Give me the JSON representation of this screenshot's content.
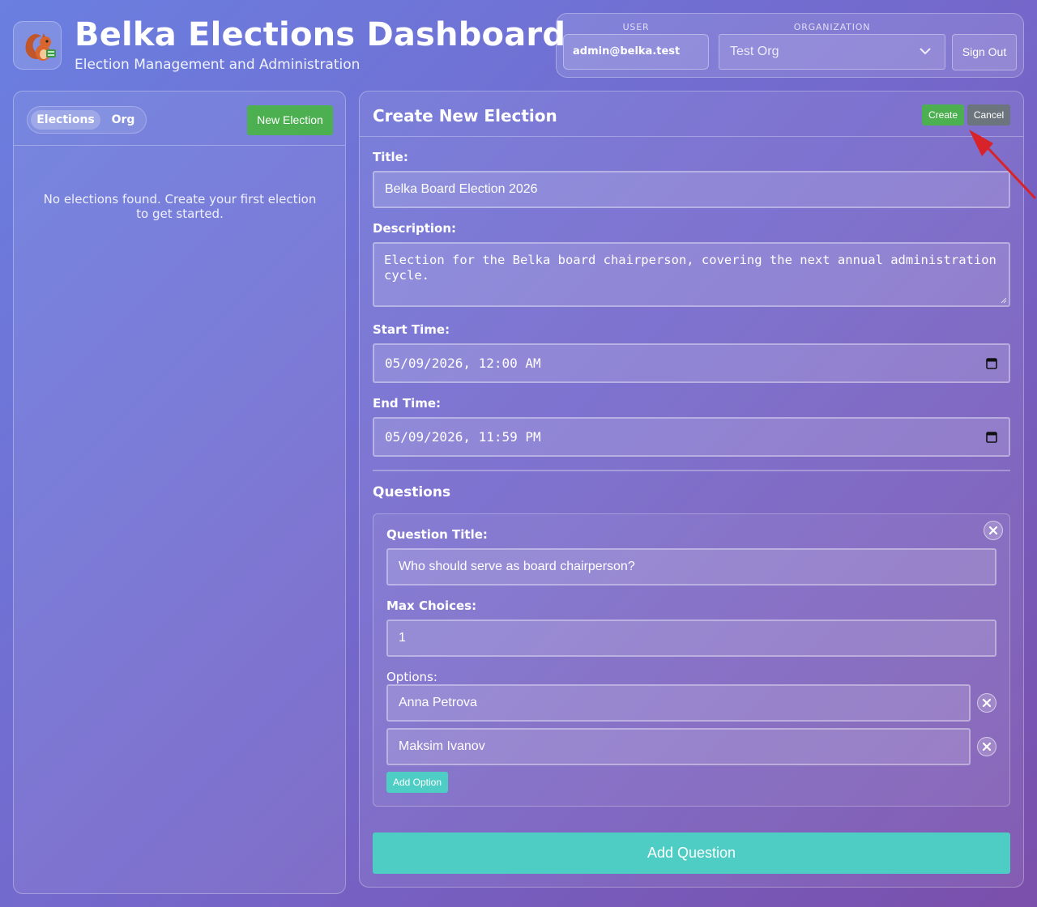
{
  "header": {
    "app_title": "Belka Elections Dashboard",
    "app_subtitle": "Election Management and Administration",
    "user_label": "USER",
    "user_value": "admin@belka.test",
    "org_label": "ORGANIZATION",
    "org_selected": "Test Org",
    "sign_out_label": "Sign Out",
    "logo_icon": "squirrel-icon"
  },
  "sidebar": {
    "tabs": [
      {
        "label": "Elections",
        "active": true
      },
      {
        "label": "Org",
        "active": false
      }
    ],
    "new_election_label": "New Election",
    "empty_message": "No elections found. Create your first election to get started."
  },
  "form": {
    "heading": "Create New Election",
    "create_label": "Create",
    "cancel_label": "Cancel",
    "title_label": "Title:",
    "title_value": "Belka Board Election 2026",
    "description_label": "Description:",
    "description_value": "Election for the Belka board chairperson, covering the next annual administration cycle.",
    "start_label": "Start Time:",
    "start_value": "05/09/2026, 12:00 AM",
    "end_label": "End Time:",
    "end_value": "05/09/2026, 11:59 PM",
    "questions_heading": "Questions",
    "question": {
      "title_label": "Question Title:",
      "title_value": "Who should serve as board chairperson?",
      "max_choices_label": "Max Choices:",
      "max_choices_value": "1",
      "options_label": "Options:",
      "options": [
        "Anna Petrova",
        "Maksim Ivanov"
      ],
      "add_option_label": "Add Option"
    },
    "add_question_label": "Add Question"
  },
  "colors": {
    "success": "#4caf50",
    "secondary": "#6c757d",
    "teal": "#4ecdc4",
    "annotation_arrow": "#d9232a"
  }
}
